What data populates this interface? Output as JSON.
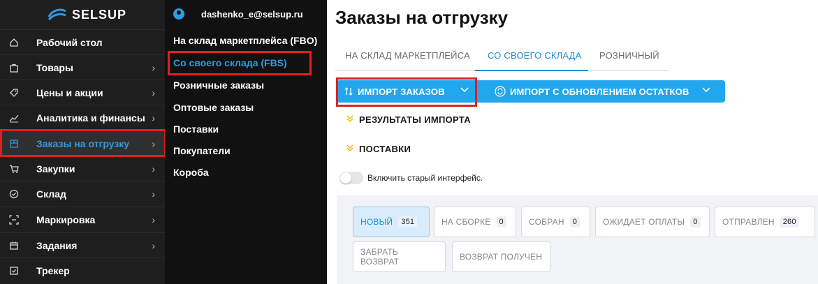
{
  "brand": {
    "name": "SELSUP",
    "accent": "#2f9be0"
  },
  "sidebar": {
    "items": [
      {
        "label": "Рабочий стол",
        "icon": "home-icon",
        "has_chevron": false
      },
      {
        "label": "Товары",
        "icon": "bag-icon",
        "has_chevron": true
      },
      {
        "label": "Цены и акции",
        "icon": "tag-icon",
        "has_chevron": true
      },
      {
        "label": "Аналитика и финансы",
        "icon": "chart-icon",
        "has_chevron": true
      },
      {
        "label": "Заказы на отгрузку",
        "icon": "box-icon",
        "has_chevron": true,
        "active": true
      },
      {
        "label": "Закупки",
        "icon": "cart-icon",
        "has_chevron": true
      },
      {
        "label": "Склад",
        "icon": "check-circle-icon",
        "has_chevron": true
      },
      {
        "label": "Маркировка",
        "icon": "scan-icon",
        "has_chevron": true
      },
      {
        "label": "Задания",
        "icon": "calendar-icon",
        "has_chevron": true
      },
      {
        "label": "Трекер",
        "icon": "tracker-icon",
        "has_chevron": false
      }
    ]
  },
  "submenu": {
    "user_email": "dashenko_e@selsup.ru",
    "items": [
      {
        "label": "На склад маркетплейса (FBO)"
      },
      {
        "label": "Со своего склада (FBS)",
        "active": true
      },
      {
        "label": "Розничные заказы"
      },
      {
        "label": "Оптовые заказы"
      },
      {
        "label": "Поставки"
      },
      {
        "label": "Покупатели"
      },
      {
        "label": "Короба"
      }
    ]
  },
  "main": {
    "title": "Заказы на отгрузку",
    "tabs": [
      {
        "label": "НА СКЛАД МАРКЕТПЛЕЙСА"
      },
      {
        "label": "СО СВОЕГО СКЛАДА",
        "active": true
      },
      {
        "label": "РОЗНИЧНЫЙ"
      }
    ],
    "actions": {
      "import_orders": "ИМПОРТ ЗАКАЗОВ",
      "import_with_stock": "ИМПОРТ С ОБНОВЛЕНИЕМ ОСТАТКОВ"
    },
    "sections": [
      {
        "label": "РЕЗУЛЬТАТЫ ИМПОРТА"
      },
      {
        "label": "ПОСТАВКИ"
      }
    ],
    "toggle_label": "Включить старый интерфейс.",
    "statuses": [
      {
        "label": "НОВЫЙ",
        "count": "351",
        "active": true
      },
      {
        "label": "НА СБОРКЕ",
        "count": "0"
      },
      {
        "label": "СОБРАН",
        "count": "0"
      },
      {
        "label": "ОЖИДАЕТ ОПЛАТЫ",
        "count": "0"
      },
      {
        "label": "ОТПРАВЛЕН",
        "count": "260"
      },
      {
        "label": "ЗАБРАТЬ ВОЗВРАТ"
      },
      {
        "label": "ВОЗВРАТ ПОЛУЧЕН"
      }
    ]
  }
}
